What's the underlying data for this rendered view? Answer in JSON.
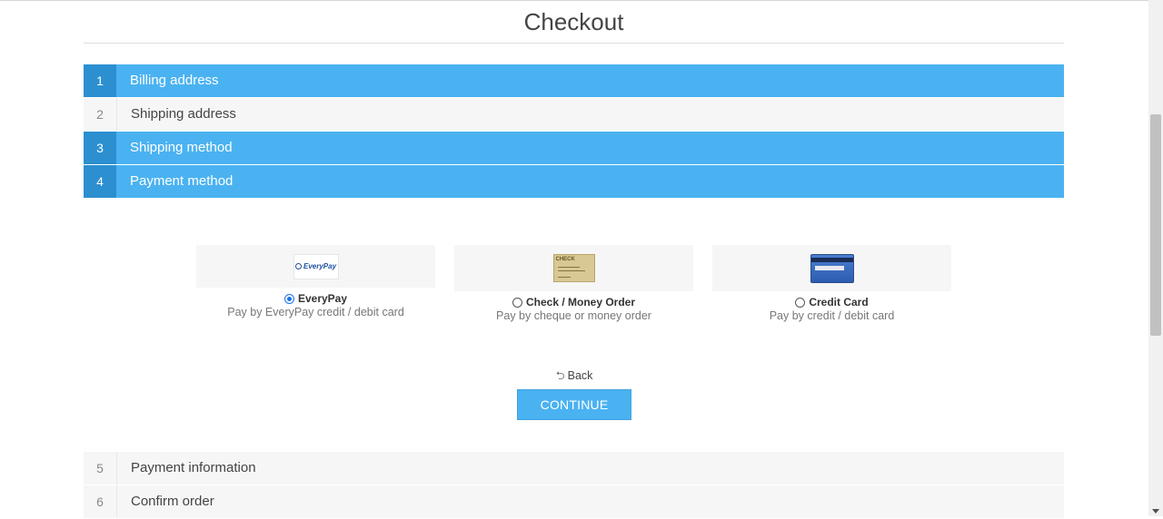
{
  "page": {
    "title": "Checkout"
  },
  "steps": [
    {
      "number": "1",
      "label": "Billing address",
      "state": "active"
    },
    {
      "number": "2",
      "label": "Shipping address",
      "state": "inactive"
    },
    {
      "number": "3",
      "label": "Shipping method",
      "state": "active"
    },
    {
      "number": "4",
      "label": "Payment method",
      "state": "active"
    }
  ],
  "payment_methods": [
    {
      "name": "EveryPay",
      "description": "Pay by EveryPay credit / debit card",
      "selected": true,
      "logo_text": "EveryPay"
    },
    {
      "name": "Check / Money Order",
      "description": "Pay by cheque or money order",
      "selected": false,
      "logo_text": "CHECK"
    },
    {
      "name": "Credit Card",
      "description": "Pay by credit / debit card",
      "selected": false
    }
  ],
  "actions": {
    "back_label": "Back",
    "continue_label": "CONTINUE"
  },
  "remaining_steps": [
    {
      "number": "5",
      "label": "Payment information"
    },
    {
      "number": "6",
      "label": "Confirm order"
    }
  ],
  "colors": {
    "accent": "#4ab2f1",
    "accent_dark": "#2b8fd0",
    "inactive_bg": "#f6f6f6"
  }
}
